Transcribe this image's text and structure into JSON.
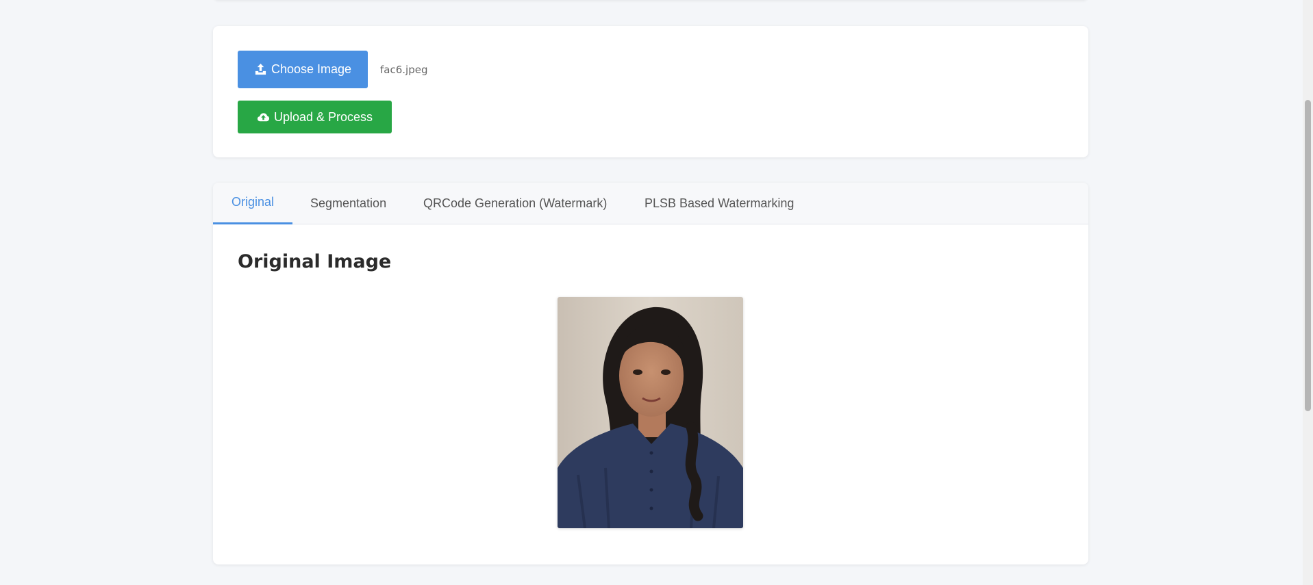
{
  "upload": {
    "choose_label": "Choose Image",
    "filename": "fac6.jpeg",
    "upload_label": "Upload & Process"
  },
  "tabs": [
    {
      "label": "Original",
      "active": true
    },
    {
      "label": "Segmentation",
      "active": false
    },
    {
      "label": "QRCode Generation (Watermark)",
      "active": false
    },
    {
      "label": "PLSB Based Watermarking",
      "active": false
    }
  ],
  "original_panel": {
    "title": "Original Image"
  },
  "colors": {
    "primary": "#4a90e2",
    "success": "#28a745",
    "background": "#f4f6f9"
  },
  "icons": {
    "choose": "upload-icon",
    "upload": "cloud-upload-icon"
  }
}
